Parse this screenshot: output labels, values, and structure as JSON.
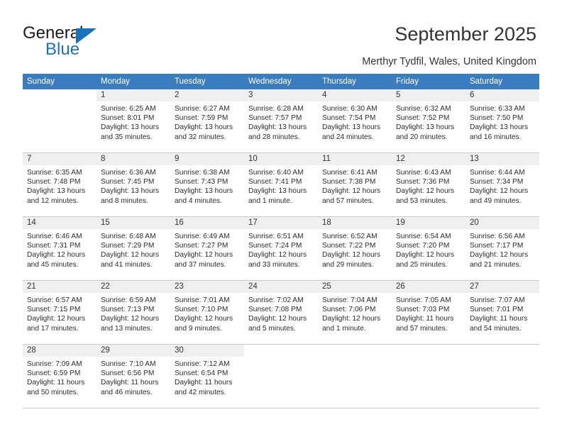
{
  "brand": {
    "name_part1": "General",
    "name_part2": "Blue",
    "accent_color": "#1773bd"
  },
  "header": {
    "title": "September 2025",
    "subtitle": "Merthyr Tydfil, Wales, United Kingdom"
  },
  "theme": {
    "header_row_bg": "#3a7dbf",
    "header_row_text": "#ffffff",
    "daynum_band_bg": "#efefef",
    "grid_line": "#c9c9c9"
  },
  "calendar": {
    "weekday_headers": [
      "Sunday",
      "Monday",
      "Tuesday",
      "Wednesday",
      "Thursday",
      "Friday",
      "Saturday"
    ],
    "weeks": [
      [
        {
          "day": "",
          "sunrise": "",
          "sunset": "",
          "daylight_line1": "",
          "daylight_line2": "",
          "empty": true
        },
        {
          "day": "1",
          "sunrise": "Sunrise: 6:25 AM",
          "sunset": "Sunset: 8:01 PM",
          "daylight_line1": "Daylight: 13 hours",
          "daylight_line2": "and 35 minutes."
        },
        {
          "day": "2",
          "sunrise": "Sunrise: 6:27 AM",
          "sunset": "Sunset: 7:59 PM",
          "daylight_line1": "Daylight: 13 hours",
          "daylight_line2": "and 32 minutes."
        },
        {
          "day": "3",
          "sunrise": "Sunrise: 6:28 AM",
          "sunset": "Sunset: 7:57 PM",
          "daylight_line1": "Daylight: 13 hours",
          "daylight_line2": "and 28 minutes."
        },
        {
          "day": "4",
          "sunrise": "Sunrise: 6:30 AM",
          "sunset": "Sunset: 7:54 PM",
          "daylight_line1": "Daylight: 13 hours",
          "daylight_line2": "and 24 minutes."
        },
        {
          "day": "5",
          "sunrise": "Sunrise: 6:32 AM",
          "sunset": "Sunset: 7:52 PM",
          "daylight_line1": "Daylight: 13 hours",
          "daylight_line2": "and 20 minutes."
        },
        {
          "day": "6",
          "sunrise": "Sunrise: 6:33 AM",
          "sunset": "Sunset: 7:50 PM",
          "daylight_line1": "Daylight: 13 hours",
          "daylight_line2": "and 16 minutes."
        }
      ],
      [
        {
          "day": "7",
          "sunrise": "Sunrise: 6:35 AM",
          "sunset": "Sunset: 7:48 PM",
          "daylight_line1": "Daylight: 13 hours",
          "daylight_line2": "and 12 minutes."
        },
        {
          "day": "8",
          "sunrise": "Sunrise: 6:36 AM",
          "sunset": "Sunset: 7:45 PM",
          "daylight_line1": "Daylight: 13 hours",
          "daylight_line2": "and 8 minutes."
        },
        {
          "day": "9",
          "sunrise": "Sunrise: 6:38 AM",
          "sunset": "Sunset: 7:43 PM",
          "daylight_line1": "Daylight: 13 hours",
          "daylight_line2": "and 4 minutes."
        },
        {
          "day": "10",
          "sunrise": "Sunrise: 6:40 AM",
          "sunset": "Sunset: 7:41 PM",
          "daylight_line1": "Daylight: 13 hours",
          "daylight_line2": "and 1 minute."
        },
        {
          "day": "11",
          "sunrise": "Sunrise: 6:41 AM",
          "sunset": "Sunset: 7:38 PM",
          "daylight_line1": "Daylight: 12 hours",
          "daylight_line2": "and 57 minutes."
        },
        {
          "day": "12",
          "sunrise": "Sunrise: 6:43 AM",
          "sunset": "Sunset: 7:36 PM",
          "daylight_line1": "Daylight: 12 hours",
          "daylight_line2": "and 53 minutes."
        },
        {
          "day": "13",
          "sunrise": "Sunrise: 6:44 AM",
          "sunset": "Sunset: 7:34 PM",
          "daylight_line1": "Daylight: 12 hours",
          "daylight_line2": "and 49 minutes."
        }
      ],
      [
        {
          "day": "14",
          "sunrise": "Sunrise: 6:46 AM",
          "sunset": "Sunset: 7:31 PM",
          "daylight_line1": "Daylight: 12 hours",
          "daylight_line2": "and 45 minutes."
        },
        {
          "day": "15",
          "sunrise": "Sunrise: 6:48 AM",
          "sunset": "Sunset: 7:29 PM",
          "daylight_line1": "Daylight: 12 hours",
          "daylight_line2": "and 41 minutes."
        },
        {
          "day": "16",
          "sunrise": "Sunrise: 6:49 AM",
          "sunset": "Sunset: 7:27 PM",
          "daylight_line1": "Daylight: 12 hours",
          "daylight_line2": "and 37 minutes."
        },
        {
          "day": "17",
          "sunrise": "Sunrise: 6:51 AM",
          "sunset": "Sunset: 7:24 PM",
          "daylight_line1": "Daylight: 12 hours",
          "daylight_line2": "and 33 minutes."
        },
        {
          "day": "18",
          "sunrise": "Sunrise: 6:52 AM",
          "sunset": "Sunset: 7:22 PM",
          "daylight_line1": "Daylight: 12 hours",
          "daylight_line2": "and 29 minutes."
        },
        {
          "day": "19",
          "sunrise": "Sunrise: 6:54 AM",
          "sunset": "Sunset: 7:20 PM",
          "daylight_line1": "Daylight: 12 hours",
          "daylight_line2": "and 25 minutes."
        },
        {
          "day": "20",
          "sunrise": "Sunrise: 6:56 AM",
          "sunset": "Sunset: 7:17 PM",
          "daylight_line1": "Daylight: 12 hours",
          "daylight_line2": "and 21 minutes."
        }
      ],
      [
        {
          "day": "21",
          "sunrise": "Sunrise: 6:57 AM",
          "sunset": "Sunset: 7:15 PM",
          "daylight_line1": "Daylight: 12 hours",
          "daylight_line2": "and 17 minutes."
        },
        {
          "day": "22",
          "sunrise": "Sunrise: 6:59 AM",
          "sunset": "Sunset: 7:13 PM",
          "daylight_line1": "Daylight: 12 hours",
          "daylight_line2": "and 13 minutes."
        },
        {
          "day": "23",
          "sunrise": "Sunrise: 7:01 AM",
          "sunset": "Sunset: 7:10 PM",
          "daylight_line1": "Daylight: 12 hours",
          "daylight_line2": "and 9 minutes."
        },
        {
          "day": "24",
          "sunrise": "Sunrise: 7:02 AM",
          "sunset": "Sunset: 7:08 PM",
          "daylight_line1": "Daylight: 12 hours",
          "daylight_line2": "and 5 minutes."
        },
        {
          "day": "25",
          "sunrise": "Sunrise: 7:04 AM",
          "sunset": "Sunset: 7:06 PM",
          "daylight_line1": "Daylight: 12 hours",
          "daylight_line2": "and 1 minute."
        },
        {
          "day": "26",
          "sunrise": "Sunrise: 7:05 AM",
          "sunset": "Sunset: 7:03 PM",
          "daylight_line1": "Daylight: 11 hours",
          "daylight_line2": "and 57 minutes."
        },
        {
          "day": "27",
          "sunrise": "Sunrise: 7:07 AM",
          "sunset": "Sunset: 7:01 PM",
          "daylight_line1": "Daylight: 11 hours",
          "daylight_line2": "and 54 minutes."
        }
      ],
      [
        {
          "day": "28",
          "sunrise": "Sunrise: 7:09 AM",
          "sunset": "Sunset: 6:59 PM",
          "daylight_line1": "Daylight: 11 hours",
          "daylight_line2": "and 50 minutes."
        },
        {
          "day": "29",
          "sunrise": "Sunrise: 7:10 AM",
          "sunset": "Sunset: 6:56 PM",
          "daylight_line1": "Daylight: 11 hours",
          "daylight_line2": "and 46 minutes."
        },
        {
          "day": "30",
          "sunrise": "Sunrise: 7:12 AM",
          "sunset": "Sunset: 6:54 PM",
          "daylight_line1": "Daylight: 11 hours",
          "daylight_line2": "and 42 minutes."
        },
        {
          "day": "",
          "sunrise": "",
          "sunset": "",
          "daylight_line1": "",
          "daylight_line2": "",
          "empty": true
        },
        {
          "day": "",
          "sunrise": "",
          "sunset": "",
          "daylight_line1": "",
          "daylight_line2": "",
          "empty": true
        },
        {
          "day": "",
          "sunrise": "",
          "sunset": "",
          "daylight_line1": "",
          "daylight_line2": "",
          "empty": true
        },
        {
          "day": "",
          "sunrise": "",
          "sunset": "",
          "daylight_line1": "",
          "daylight_line2": "",
          "empty": true
        }
      ]
    ]
  }
}
